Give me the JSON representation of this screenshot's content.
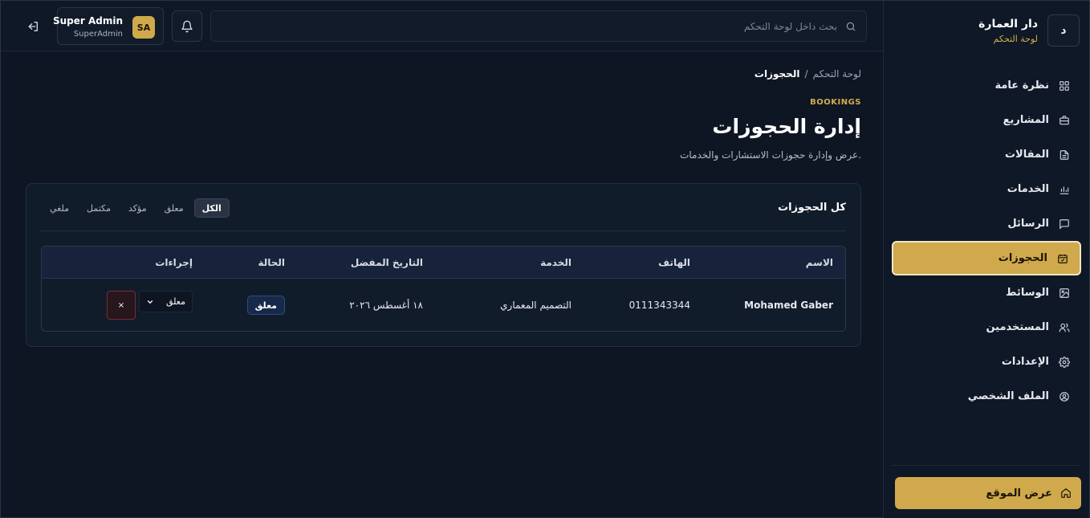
{
  "brand": {
    "badge": "د",
    "title": "دار العمارة",
    "subtitle": "لوحة التحكم"
  },
  "sidebar": {
    "items": [
      {
        "label": "نظرة عامة",
        "icon": "grid-icon"
      },
      {
        "label": "المشاريع",
        "icon": "briefcase-icon"
      },
      {
        "label": "المقالات",
        "icon": "document-icon"
      },
      {
        "label": "الخدمات",
        "icon": "bar-chart-icon"
      },
      {
        "label": "الرسائل",
        "icon": "message-icon"
      },
      {
        "label": "الحجوزات",
        "icon": "calendar-check-icon",
        "active": true
      },
      {
        "label": "الوسائط",
        "icon": "image-icon"
      },
      {
        "label": "المستخدمين",
        "icon": "users-icon"
      },
      {
        "label": "الإعدادات",
        "icon": "gear-icon"
      },
      {
        "label": "الملف الشخصي",
        "icon": "user-circle-icon"
      }
    ],
    "view_site": "عرض الموقع"
  },
  "topbar": {
    "search_placeholder": "بحث داخل لوحة التحكم",
    "user": {
      "initials": "SA",
      "name": "Super Admin",
      "role": "SuperAdmin"
    }
  },
  "page": {
    "breadcrumb": {
      "root": "لوحة التحكم",
      "separator": "/",
      "current": "الحجوزات"
    },
    "eyebrow": "BOOKINGS",
    "title": "إدارة الحجوزات",
    "subtitle": "عرض وإدارة حجوزات الاستشارات والخدمات."
  },
  "card": {
    "title": "كل الحجوزات",
    "tabs": [
      {
        "label": "الكل",
        "active": true
      },
      {
        "label": "معلق"
      },
      {
        "label": "مؤكد"
      },
      {
        "label": "مكتمل"
      },
      {
        "label": "ملغي"
      }
    ]
  },
  "table": {
    "headers": {
      "name": "الاسم",
      "phone": "الهاتف",
      "service": "الخدمة",
      "date": "التاريخ المفضل",
      "status": "الحالة",
      "actions": "إجراءات"
    },
    "rows": [
      {
        "name": "Mohamed Gaber",
        "phone": "0111343344",
        "service": "التصميم المعماري",
        "date": "١٨ أغسطس ٢٠٢٦",
        "status": "معلق",
        "status_select": "معلق",
        "delete": "×"
      }
    ]
  },
  "colors": {
    "accent": "#cfa94b",
    "background": "#0e1624",
    "danger": "#7a2b33"
  }
}
